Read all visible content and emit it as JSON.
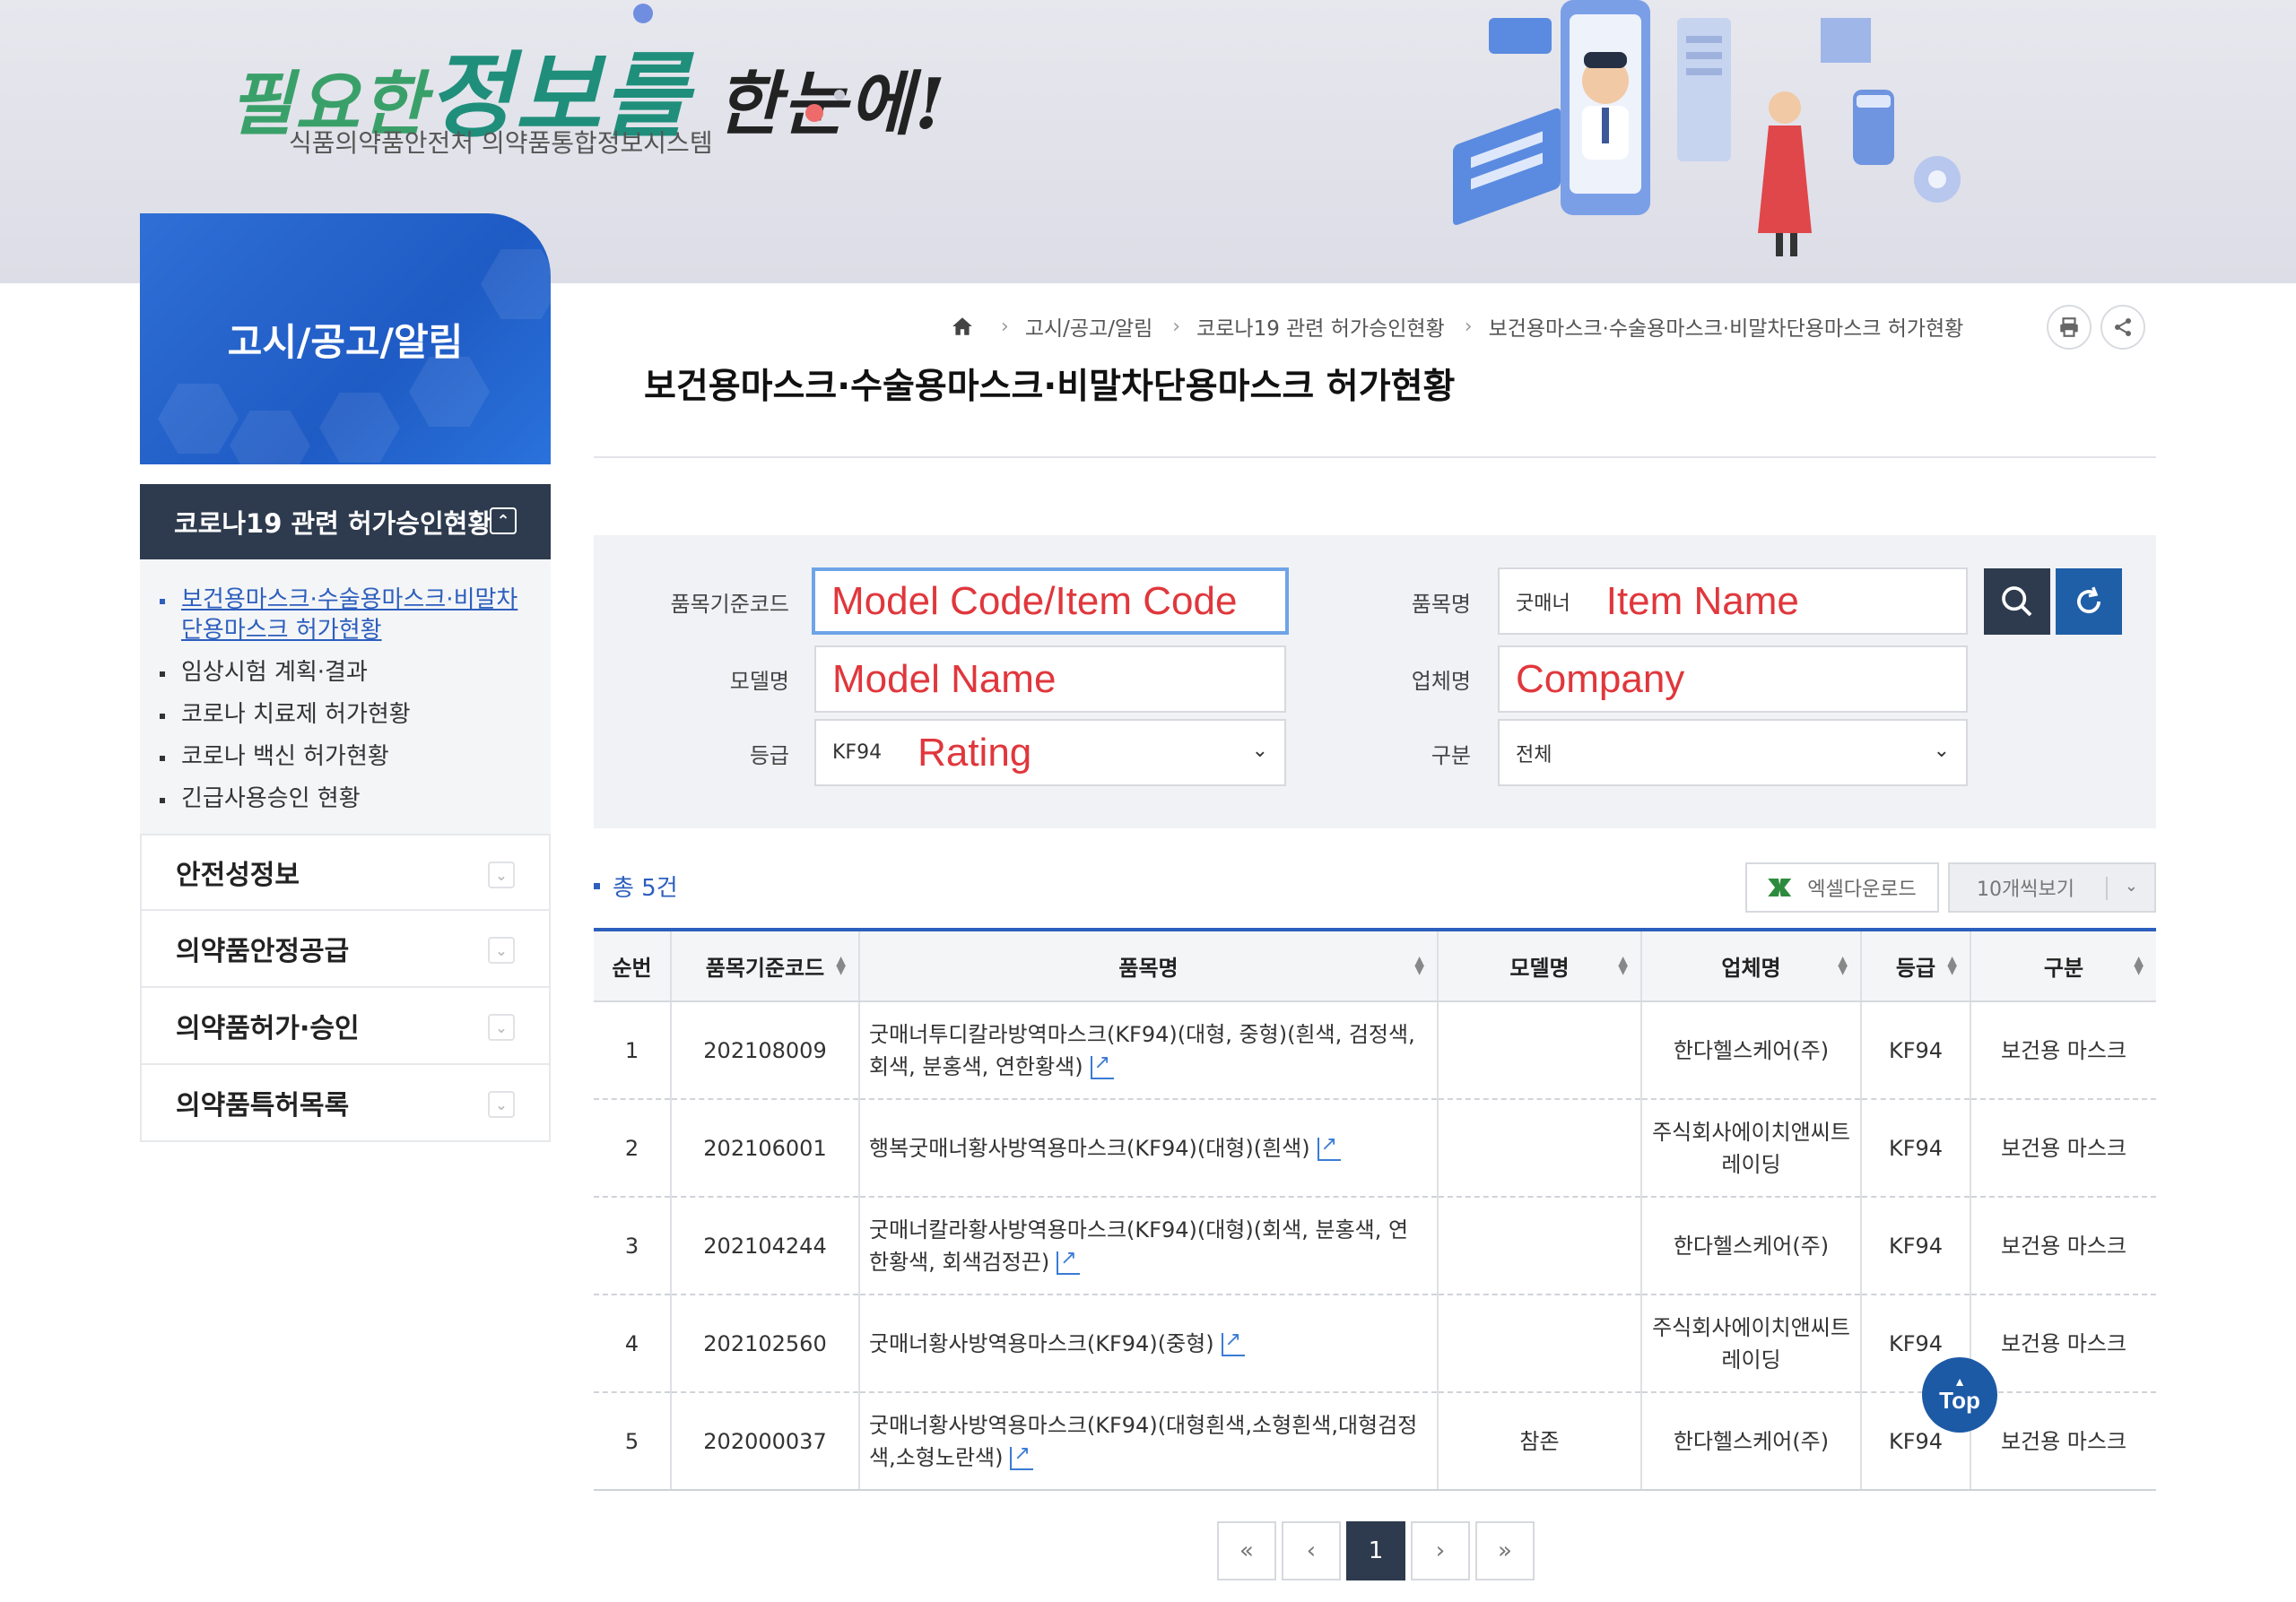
{
  "banner": {
    "slogan_part1": "필요한",
    "slogan_part2": "정보를",
    "slogan_part3": "한눈에!",
    "subtitle": "식품의약품안전처 의약품통합정보시스템"
  },
  "sidebar": {
    "hero_title": "고시/공고/알림",
    "active_menu": "코로나19 관련 허가승인현황",
    "sub_items": [
      {
        "label": "보건용마스크·수술용마스크·비말차단용마스크 허가현황"
      },
      {
        "label": "임상시험 계획·결과"
      },
      {
        "label": "코로나 치료제 허가현황"
      },
      {
        "label": "코로나 백신 허가현황"
      },
      {
        "label": "긴급사용승인 현황"
      }
    ],
    "menus": [
      {
        "label": "안전성정보"
      },
      {
        "label": "의약품안정공급"
      },
      {
        "label": "의약품허가·승인"
      },
      {
        "label": "의약품특허목록"
      }
    ]
  },
  "breadcrumb": {
    "items": [
      "고시/공고/알림",
      "코로나19 관련 허가승인현황",
      "보건용마스크·수술용마스크·비말차단용마스크 허가현황"
    ]
  },
  "page": {
    "title": "보건용마스크·수술용마스크·비말차단용마스크 허가현황"
  },
  "search": {
    "code_label": "품목기준코드",
    "code_value": "Model Code/Item Code",
    "item_label": "품목명",
    "item_prefix": "굿매너",
    "item_value": "Item Name",
    "model_label": "모델명",
    "model_value": "Model Name",
    "company_label": "업체명",
    "company_value": "Company",
    "grade_label": "등급",
    "grade_prefix": "KF94",
    "grade_value": "Rating",
    "type_label": "구분",
    "type_value": "전체"
  },
  "results": {
    "total": "총 5건",
    "excel_label": "엑셀다운로드",
    "view_label": "10개씩보기"
  },
  "table": {
    "headers": [
      "순번",
      "품목기준코드",
      "품목명",
      "모델명",
      "업체명",
      "등급",
      "구분"
    ],
    "rows": [
      {
        "no": "1",
        "code": "202108009",
        "name": "굿매너투디칼라방역마스크(KF94)(대형, 중형)(흰색, 검정색, 회색, 분홍색, 연한황색)",
        "model": "",
        "company": "한다헬스케어(주)",
        "grade": "KF94",
        "type": "보건용 마스크"
      },
      {
        "no": "2",
        "code": "202106001",
        "name": "행복굿매너황사방역용마스크(KF94)(대형)(흰색)",
        "model": "",
        "company": "주식회사에이치앤씨트레이딩",
        "grade": "KF94",
        "type": "보건용 마스크"
      },
      {
        "no": "3",
        "code": "202104244",
        "name": "굿매너칼라황사방역용마스크(KF94)(대형)(회색, 분홍색, 연한황색, 회색검정끈)",
        "model": "",
        "company": "한다헬스케어(주)",
        "grade": "KF94",
        "type": "보건용 마스크"
      },
      {
        "no": "4",
        "code": "202102560",
        "name": "굿매너황사방역용마스크(KF94)(중형)",
        "model": "",
        "company": "주식회사에이치앤씨트레이딩",
        "grade": "KF94",
        "type": "보건용 마스크"
      },
      {
        "no": "5",
        "code": "202000037",
        "name": "굿매너황사방역용마스크(KF94)(대형흰색,소형흰색,대형검정색,소형노란색)",
        "model": "참존",
        "company": "한다헬스케어(주)",
        "grade": "KF94",
        "type": "보건용 마스크"
      }
    ]
  },
  "pagination": {
    "first": "«",
    "prev": "‹",
    "current": "1",
    "next": "›",
    "last": "»"
  },
  "top_button": {
    "label": "Top"
  },
  "colors": {
    "accent_navy": "#2e3b4e",
    "accent_blue": "#2d5fbd",
    "annotation_red": "#e0373c"
  }
}
